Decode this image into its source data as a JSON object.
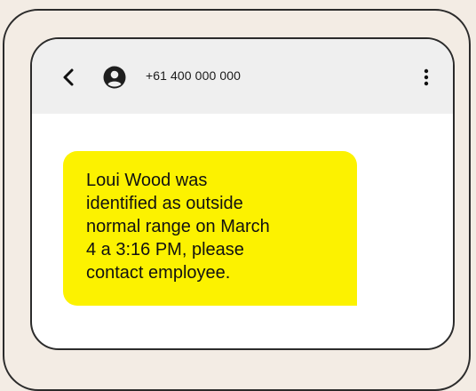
{
  "header": {
    "contact_number": "+61 400 000 000",
    "back_icon": "chevron-left-icon",
    "avatar_icon": "person-avatar-icon",
    "more_icon": "vertical-dots-icon"
  },
  "message": {
    "text": "Loui Wood was\nidentified as outside\nnormal range on March\n4 a 3:16 PM, please\ncontact employee.",
    "bubble_color": "#fcf200"
  },
  "colors": {
    "background": "#f3ece4",
    "frame_stroke": "#2b2b2b",
    "header_bg": "#efefef"
  }
}
